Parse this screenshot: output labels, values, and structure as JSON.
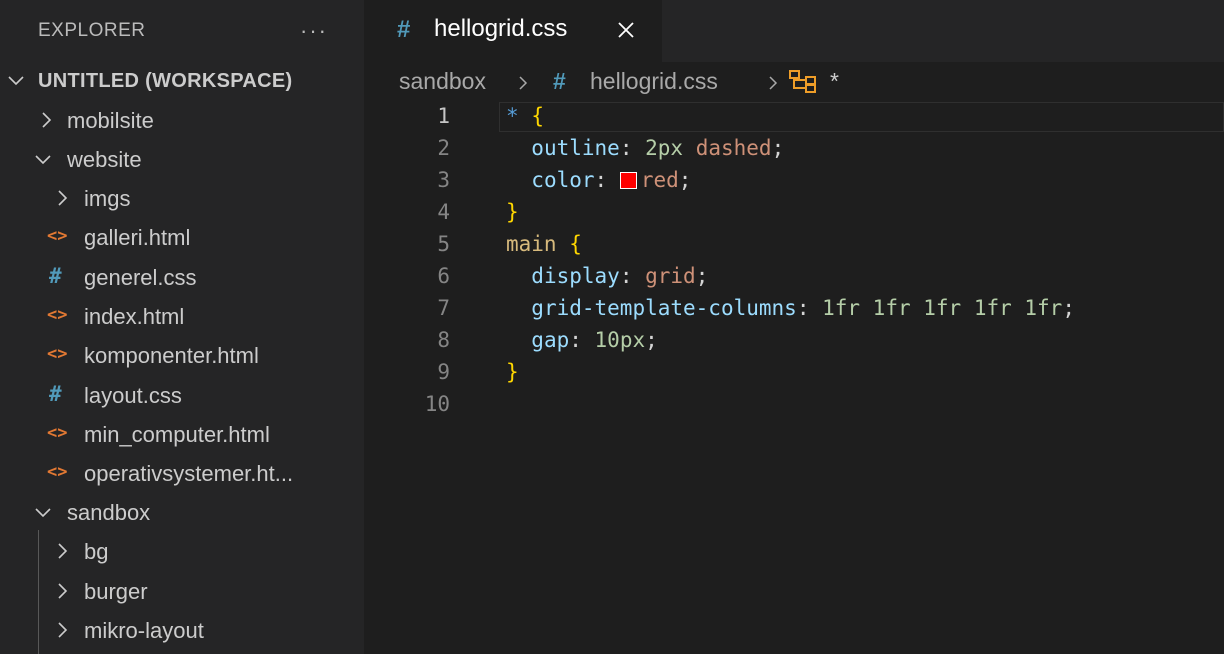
{
  "explorer": {
    "title": "EXPLORER",
    "more": "···",
    "workspace": "UNTITLED (WORKSPACE)",
    "items": [
      {
        "label": "mobilsite",
        "kind": "folder-collapsed",
        "depth": 0
      },
      {
        "label": "website",
        "kind": "folder-expanded",
        "depth": 0
      },
      {
        "label": "imgs",
        "kind": "folder-collapsed",
        "depth": 1
      },
      {
        "label": "galleri.html",
        "kind": "html",
        "depth": 1
      },
      {
        "label": "generel.css",
        "kind": "css",
        "depth": 1
      },
      {
        "label": "index.html",
        "kind": "html",
        "depth": 1
      },
      {
        "label": "komponenter.html",
        "kind": "html",
        "depth": 1
      },
      {
        "label": "layout.css",
        "kind": "css",
        "depth": 1
      },
      {
        "label": "min_computer.html",
        "kind": "html",
        "depth": 1
      },
      {
        "label": "operativsystemer.ht...",
        "kind": "html",
        "depth": 1
      },
      {
        "label": "sandbox",
        "kind": "folder-expanded",
        "depth": 0
      },
      {
        "label": "bg",
        "kind": "folder-collapsed",
        "depth": 1
      },
      {
        "label": "burger",
        "kind": "folder-collapsed",
        "depth": 1
      },
      {
        "label": "mikro-layout",
        "kind": "folder-collapsed",
        "depth": 1
      }
    ]
  },
  "tab": {
    "icon": "#",
    "label": "hellogrid.css"
  },
  "breadcrumb": {
    "folder": "sandbox",
    "file_icon": "#",
    "file": "hellogrid.css",
    "symbol": "*"
  },
  "editor": {
    "active_line": 1,
    "line_numbers": [
      "1",
      "2",
      "3",
      "4",
      "5",
      "6",
      "7",
      "8",
      "9",
      "10"
    ],
    "lines": {
      "l1_sel": "*",
      "l1_brace": "{",
      "l2_prop": "outline",
      "l2_num": "2px",
      "l2_val": "dashed",
      "l3_prop": "color",
      "l3_val": "red",
      "l4_brace": "}",
      "l5_sel": "main",
      "l5_brace": "{",
      "l6_prop": "display",
      "l6_val": "grid",
      "l7_prop": "grid-template-columns",
      "l7_num": "1fr 1fr 1fr 1fr 1fr",
      "l8_prop": "gap",
      "l8_num": "10px",
      "l9_brace": "}"
    },
    "color_swatch": "#ff0000"
  }
}
